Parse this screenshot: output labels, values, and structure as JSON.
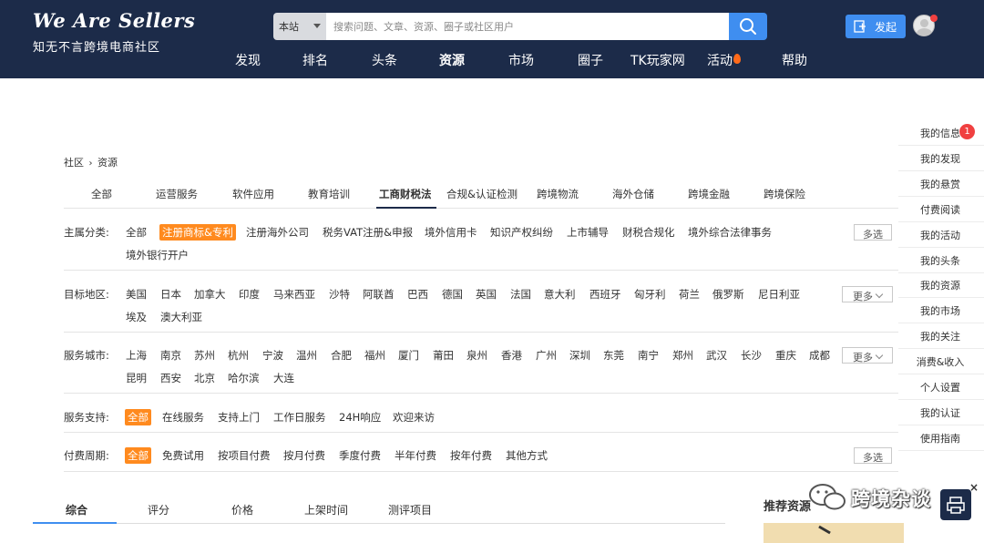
{
  "header": {
    "logo_title": "We Are Sellers",
    "logo_subtitle": "知无不言跨境电商社区",
    "search": {
      "scope": "本站",
      "placeholder": "搜索问题、文章、资源、圈子或社区用户"
    },
    "post_label": "发起",
    "nav": [
      {
        "label": "发现",
        "active": false
      },
      {
        "label": "排名",
        "active": false
      },
      {
        "label": "头条",
        "active": false
      },
      {
        "label": "资源",
        "active": true
      },
      {
        "label": "市场",
        "active": false
      },
      {
        "label": "圈子",
        "active": false
      },
      {
        "label": "TK玩家网",
        "active": false
      },
      {
        "label": "活动",
        "active": false,
        "hot": true
      },
      {
        "label": "帮助",
        "active": false
      }
    ]
  },
  "breadcrumb": {
    "root": "社区",
    "separator": "›",
    "current": "资源"
  },
  "categories": [
    "全部",
    "运营服务",
    "软件应用",
    "教育培训",
    "工商财税法",
    "合规&认证检测",
    "跨境物流",
    "海外仓储",
    "跨境金融",
    "跨境保险"
  ],
  "active_category": "工商财税法",
  "filters": {
    "main": {
      "label": "主属分类:",
      "items": [
        "全部",
        "注册商标&专利",
        "注册海外公司",
        "税务VAT注册&申报",
        "境外信用卡",
        "知识产权纠纷",
        "上市辅导",
        "财税合规化",
        "境外综合法律事务",
        "境外银行开户"
      ],
      "selected": "注册商标&专利",
      "button": "多选"
    },
    "region": {
      "label": "目标地区:",
      "items": [
        "美国",
        "日本",
        "加拿大",
        "印度",
        "马来西亚",
        "沙特",
        "阿联酋",
        "巴西",
        "德国",
        "英国",
        "法国",
        "意大利",
        "西班牙",
        "匈牙利",
        "荷兰",
        "俄罗斯",
        "尼日利亚",
        "埃及",
        "澳大利亚"
      ],
      "button": "更多"
    },
    "city": {
      "label": "服务城市:",
      "items": [
        "上海",
        "南京",
        "苏州",
        "杭州",
        "宁波",
        "温州",
        "合肥",
        "福州",
        "厦门",
        "莆田",
        "泉州",
        "香港",
        "广州",
        "深圳",
        "东莞",
        "南宁",
        "郑州",
        "武汉",
        "长沙",
        "重庆",
        "成都",
        "昆明",
        "西安",
        "北京",
        "哈尔滨",
        "大连"
      ],
      "button": "更多"
    },
    "support": {
      "label": "服务支持:",
      "items": [
        "全部",
        "在线服务",
        "支持上门",
        "工作日服务",
        "24H响应",
        "欢迎来访"
      ],
      "selected": "全部"
    },
    "billing": {
      "label": "付费周期:",
      "items": [
        "全部",
        "免费试用",
        "按项目付费",
        "按月付费",
        "季度付费",
        "半年付费",
        "按年付费",
        "其他方式"
      ],
      "selected": "全部",
      "button": "多选"
    }
  },
  "sort_tabs": [
    "综合",
    "评分",
    "价格",
    "上架时间",
    "测评项目"
  ],
  "active_sort": "综合",
  "recommend_title": "推荐资源",
  "side_menu": {
    "notification_count": "1",
    "items": [
      "我的信息",
      "我的发现",
      "我的悬赏",
      "付费阅读",
      "我的活动",
      "我的头条",
      "我的资源",
      "我的市场",
      "我的关注",
      "消费&收入",
      "个人设置",
      "我的认证",
      "使用指南"
    ]
  },
  "watermark": {
    "text": "跨境杂谈",
    "close": "×"
  },
  "colors": {
    "header_bg": "#1c2b49",
    "accent_blue": "#3f8ef0",
    "selected_orange": "#ff8a1e",
    "badge_red": "#f04040"
  }
}
